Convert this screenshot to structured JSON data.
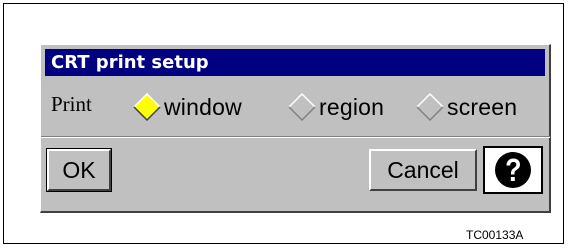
{
  "dialog": {
    "title": "CRT print setup",
    "print_label": "Print",
    "options": [
      {
        "label": "window",
        "selected": true
      },
      {
        "label": "region",
        "selected": false
      },
      {
        "label": "screen",
        "selected": false
      }
    ],
    "buttons": {
      "ok_label": "OK",
      "cancel_label": "Cancel",
      "help_icon": "question-mark-icon"
    },
    "colors": {
      "titlebar": "#000080",
      "title_text": "#ffffff",
      "dialog_bg": "#c0c0c0",
      "selected_diamond": "#ffff00"
    }
  },
  "figure_code": "TC00133A"
}
